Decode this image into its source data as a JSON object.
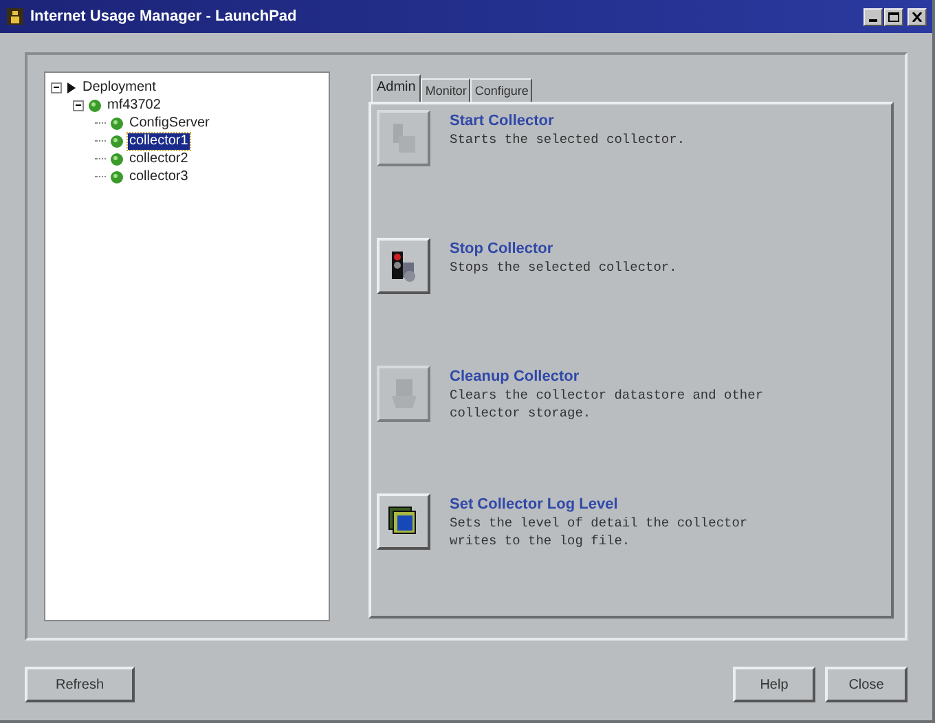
{
  "window": {
    "title": "Internet Usage Manager - LaunchPad"
  },
  "tree": [
    {
      "label": "Deployment",
      "kind": "folder",
      "expanded": true,
      "selected": false,
      "children": [
        {
          "label": "mf43702",
          "kind": "host",
          "expanded": true,
          "selected": false,
          "children": [
            {
              "label": "ConfigServer",
              "kind": "host",
              "selected": false
            },
            {
              "label": "collector1",
              "kind": "host",
              "selected": true
            },
            {
              "label": "collector2",
              "kind": "host",
              "selected": false
            },
            {
              "label": "collector3",
              "kind": "host",
              "selected": false
            }
          ]
        }
      ]
    }
  ],
  "tabs": [
    {
      "label": "Admin",
      "selected": true
    },
    {
      "label": "Monitor",
      "selected": false
    },
    {
      "label": "Configure",
      "selected": false
    }
  ],
  "actions": [
    {
      "kind": "start",
      "title": "Start Collector",
      "description": "Starts the selected collector.",
      "disabled": true
    },
    {
      "kind": "stop",
      "title": "Stop Collector",
      "description": "Stops the selected collector.",
      "disabled": false
    },
    {
      "kind": "cleanup",
      "title": "Cleanup Collector",
      "description": "Clears the collector datastore and other collector storage.",
      "disabled": true
    },
    {
      "kind": "loglevel",
      "title": "Set Collector Log Level",
      "description": "Sets the level of detail the collector writes to the log file.",
      "disabled": false
    }
  ],
  "buttons_left": [
    "Refresh"
  ],
  "buttons_right": [
    "Help",
    "Close"
  ]
}
